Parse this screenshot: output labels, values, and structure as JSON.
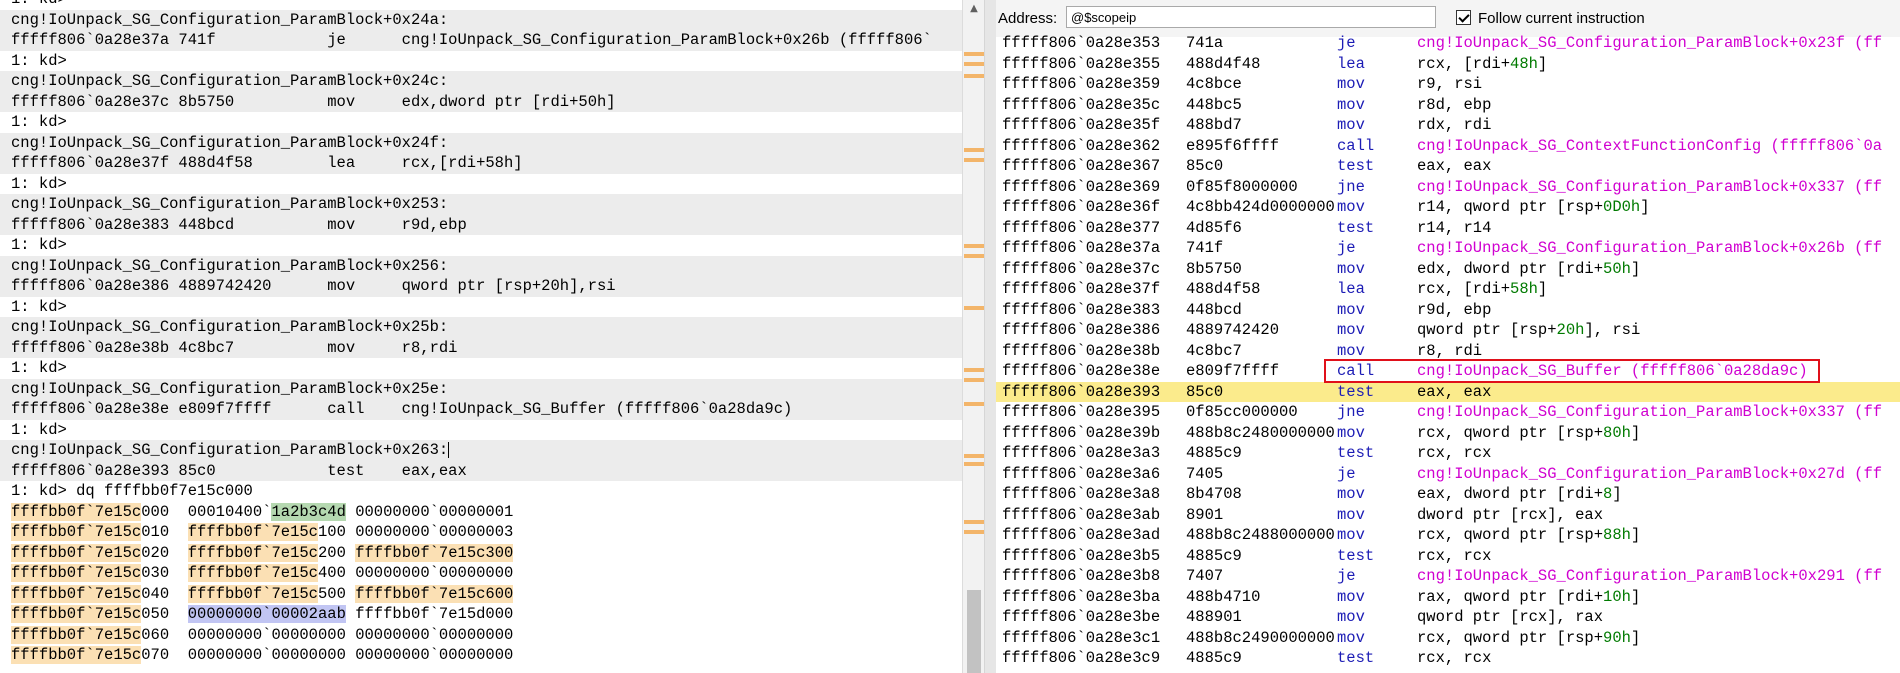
{
  "command_window": {
    "lines": [
      {
        "text": "1: kd>",
        "shade": false
      },
      {
        "text": "cng!IoUnpack_SG_Configuration_ParamBlock+0x24a:",
        "shade": true
      },
      {
        "text": "fffff806`0a28e37a 741f            je      cng!IoUnpack_SG_Configuration_ParamBlock+0x26b (fffff806`",
        "shade": true
      },
      {
        "text": "1: kd>",
        "shade": false
      },
      {
        "text": "cng!IoUnpack_SG_Configuration_ParamBlock+0x24c:",
        "shade": true
      },
      {
        "text": "fffff806`0a28e37c 8b5750          mov     edx,dword ptr [rdi+50h]",
        "shade": true
      },
      {
        "text": "1: kd>",
        "shade": false
      },
      {
        "text": "cng!IoUnpack_SG_Configuration_ParamBlock+0x24f:",
        "shade": true
      },
      {
        "text": "fffff806`0a28e37f 488d4f58        lea     rcx,[rdi+58h]",
        "shade": true
      },
      {
        "text": "1: kd>",
        "shade": false
      },
      {
        "text": "cng!IoUnpack_SG_Configuration_ParamBlock+0x253:",
        "shade": true
      },
      {
        "text": "fffff806`0a28e383 448bcd          mov     r9d,ebp",
        "shade": true
      },
      {
        "text": "1: kd>",
        "shade": false
      },
      {
        "text": "cng!IoUnpack_SG_Configuration_ParamBlock+0x256:",
        "shade": true
      },
      {
        "text": "fffff806`0a28e386 4889742420      mov     qword ptr [rsp+20h],rsi",
        "shade": true
      },
      {
        "text": "1: kd>",
        "shade": false
      },
      {
        "text": "cng!IoUnpack_SG_Configuration_ParamBlock+0x25b:",
        "shade": true
      },
      {
        "text": "fffff806`0a28e38b 4c8bc7          mov     r8,rdi",
        "shade": true
      },
      {
        "text": "1: kd>",
        "shade": false
      },
      {
        "text": "cng!IoUnpack_SG_Configuration_ParamBlock+0x25e:",
        "shade": true
      },
      {
        "text": "fffff806`0a28e38e e809f7ffff      call    cng!IoUnpack_SG_Buffer (fffff806`0a28da9c)",
        "shade": true
      },
      {
        "text": "1: kd>",
        "shade": false
      },
      {
        "text": "cng!IoUnpack_SG_Configuration_ParamBlock+0x263:",
        "shade": true,
        "cursor": true
      },
      {
        "text": "fffff806`0a28e393 85c0            test    eax,eax",
        "shade": true
      },
      {
        "text": "1: kd> dq ffffbb0f7e15c000",
        "shade": false
      }
    ],
    "dump_rows": [
      {
        "addr_hl": "ffffbb0f`7e15c",
        "addr_rest": "000",
        "q1_pre": "00010400`",
        "q1_hl": "1a2b3c4d",
        "q1_post": "",
        "q1_cls": "hg",
        "q2": "00000000`00000001",
        "q2_cls": ""
      },
      {
        "addr_hl": "ffffbb0f`7e15c",
        "addr_rest": "010",
        "q1_pre": "",
        "q1_hl": "ffffbb0f`7e15c",
        "q1_post": "100",
        "q1_cls": "hy",
        "q2": "00000000`00000003",
        "q2_cls": ""
      },
      {
        "addr_hl": "ffffbb0f`7e15c",
        "addr_rest": "020",
        "q1_pre": "",
        "q1_hl": "ffffbb0f`7e15c",
        "q1_post": "200",
        "q1_cls": "hy",
        "q2": "ffffbb0f`7e15c300",
        "q2_cls": "hy"
      },
      {
        "addr_hl": "ffffbb0f`7e15c",
        "addr_rest": "030",
        "q1_pre": "",
        "q1_hl": "ffffbb0f`7e15c",
        "q1_post": "400",
        "q1_cls": "hy",
        "q2": "00000000`00000000",
        "q2_cls": ""
      },
      {
        "addr_hl": "ffffbb0f`7e15c",
        "addr_rest": "040",
        "q1_pre": "",
        "q1_hl": "ffffbb0f`7e15c",
        "q1_post": "500",
        "q1_cls": "hy",
        "q2": "ffffbb0f`7e15c600",
        "q2_cls": "hy"
      },
      {
        "addr_hl": "ffffbb0f`7e15c",
        "addr_rest": "050",
        "q1_pre": "",
        "q1_hl": "00000000`00002aab",
        "q1_post": "",
        "q1_cls": "hb",
        "q2": "ffffbb0f`7e15d000",
        "q2_cls": ""
      },
      {
        "addr_hl": "ffffbb0f`7e15c",
        "addr_rest": "060",
        "q1_pre": "00000000`00000000",
        "q1_hl": "",
        "q1_post": "",
        "q1_cls": "",
        "q2": "00000000`00000000",
        "q2_cls": ""
      },
      {
        "addr_hl": "ffffbb0f`7e15c",
        "addr_rest": "070",
        "q1_pre": "00000000`00000000",
        "q1_hl": "",
        "q1_post": "",
        "q1_cls": "",
        "q2": "00000000`00000000",
        "q2_cls": ""
      }
    ]
  },
  "disassembly": {
    "address_label": "Address:",
    "address_value": "@$scopeip",
    "follow_label": "Follow current instruction",
    "follow_checked": true,
    "highlighted_call_index": 16,
    "current_index": 17,
    "rows": [
      {
        "addr": "fffff806`0a28e353",
        "bytes": "741a",
        "mn": "je",
        "op": "cng!IoUnpack_SG_Configuration_ParamBlock+0x23f (ff",
        "sym": true
      },
      {
        "addr": "fffff806`0a28e355",
        "bytes": "488d4f48",
        "mn": "lea",
        "op": "rcx, [rdi+|48h|]",
        "sym": false
      },
      {
        "addr": "fffff806`0a28e359",
        "bytes": "4c8bce",
        "mn": "mov",
        "op": "r9, rsi",
        "sym": false
      },
      {
        "addr": "fffff806`0a28e35c",
        "bytes": "448bc5",
        "mn": "mov",
        "op": "r8d, ebp",
        "sym": false
      },
      {
        "addr": "fffff806`0a28e35f",
        "bytes": "488bd7",
        "mn": "mov",
        "op": "rdx, rdi",
        "sym": false
      },
      {
        "addr": "fffff806`0a28e362",
        "bytes": "e895f6ffff",
        "mn": "call",
        "op": "cng!IoUnpack_SG_ContextFunctionConfig (fffff806`0a",
        "sym": true
      },
      {
        "addr": "fffff806`0a28e367",
        "bytes": "85c0",
        "mn": "test",
        "op": "eax, eax",
        "sym": false
      },
      {
        "addr": "fffff806`0a28e369",
        "bytes": "0f85f8000000",
        "mn": "jne",
        "op": "cng!IoUnpack_SG_Configuration_ParamBlock+0x337 (ff",
        "sym": true
      },
      {
        "addr": "fffff806`0a28e36f",
        "bytes": "4c8bb424d0000000",
        "mn": "mov",
        "op": "r14, qword ptr [rsp+|0D0h|]",
        "sym": false
      },
      {
        "addr": "fffff806`0a28e377",
        "bytes": "4d85f6",
        "mn": "test",
        "op": "r14, r14",
        "sym": false
      },
      {
        "addr": "fffff806`0a28e37a",
        "bytes": "741f",
        "mn": "je",
        "op": "cng!IoUnpack_SG_Configuration_ParamBlock+0x26b (ff",
        "sym": true
      },
      {
        "addr": "fffff806`0a28e37c",
        "bytes": "8b5750",
        "mn": "mov",
        "op": "edx, dword ptr [rdi+|50h|]",
        "sym": false
      },
      {
        "addr": "fffff806`0a28e37f",
        "bytes": "488d4f58",
        "mn": "lea",
        "op": "rcx, [rdi+|58h|]",
        "sym": false
      },
      {
        "addr": "fffff806`0a28e383",
        "bytes": "448bcd",
        "mn": "mov",
        "op": "r9d, ebp",
        "sym": false
      },
      {
        "addr": "fffff806`0a28e386",
        "bytes": "4889742420",
        "mn": "mov",
        "op": "qword ptr [rsp+|20h|], rsi",
        "sym": false
      },
      {
        "addr": "fffff806`0a28e38b",
        "bytes": "4c8bc7",
        "mn": "mov",
        "op": "r8, rdi",
        "sym": false
      },
      {
        "addr": "fffff806`0a28e38e",
        "bytes": "e809f7ffff",
        "mn": "call",
        "op": "cng!IoUnpack_SG_Buffer (fffff806`0a28da9c)",
        "sym": true
      },
      {
        "addr": "fffff806`0a28e393",
        "bytes": "85c0",
        "mn": "test",
        "op": "eax, eax",
        "sym": false
      },
      {
        "addr": "fffff806`0a28e395",
        "bytes": "0f85cc000000",
        "mn": "jne",
        "op": "cng!IoUnpack_SG_Configuration_ParamBlock+0x337 (ff",
        "sym": true
      },
      {
        "addr": "fffff806`0a28e39b",
        "bytes": "488b8c2480000000",
        "mn": "mov",
        "op": "rcx, qword ptr [rsp+|80h|]",
        "sym": false
      },
      {
        "addr": "fffff806`0a28e3a3",
        "bytes": "4885c9",
        "mn": "test",
        "op": "rcx, rcx",
        "sym": false
      },
      {
        "addr": "fffff806`0a28e3a6",
        "bytes": "7405",
        "mn": "je",
        "op": "cng!IoUnpack_SG_Configuration_ParamBlock+0x27d (ff",
        "sym": true
      },
      {
        "addr": "fffff806`0a28e3a8",
        "bytes": "8b4708",
        "mn": "mov",
        "op": "eax, dword ptr [rdi+|8|]",
        "sym": false
      },
      {
        "addr": "fffff806`0a28e3ab",
        "bytes": "8901",
        "mn": "mov",
        "op": "dword ptr [rcx], eax",
        "sym": false
      },
      {
        "addr": "fffff806`0a28e3ad",
        "bytes": "488b8c2488000000",
        "mn": "mov",
        "op": "rcx, qword ptr [rsp+|88h|]",
        "sym": false
      },
      {
        "addr": "fffff806`0a28e3b5",
        "bytes": "4885c9",
        "mn": "test",
        "op": "rcx, rcx",
        "sym": false
      },
      {
        "addr": "fffff806`0a28e3b8",
        "bytes": "7407",
        "mn": "je",
        "op": "cng!IoUnpack_SG_Configuration_ParamBlock+0x291 (ff",
        "sym": true
      },
      {
        "addr": "fffff806`0a28e3ba",
        "bytes": "488b4710",
        "mn": "mov",
        "op": "rax, qword ptr [rdi+|10h|]",
        "sym": false
      },
      {
        "addr": "fffff806`0a28e3be",
        "bytes": "488901",
        "mn": "mov",
        "op": "qword ptr [rcx], rax",
        "sym": false
      },
      {
        "addr": "fffff806`0a28e3c1",
        "bytes": "488b8c2490000000",
        "mn": "mov",
        "op": "rcx, qword ptr [rsp+|90h|]",
        "sym": false
      },
      {
        "addr": "fffff806`0a28e3c9",
        "bytes": "4885c9",
        "mn": "test",
        "op": "rcx, rcx",
        "sym": false
      }
    ]
  },
  "colors": {
    "symbol": "#d000d0",
    "mnemonic": "#1c1cb5",
    "number": "#007a00",
    "current_line": "#fbeb8c",
    "highlight_box": "#e0101a"
  }
}
